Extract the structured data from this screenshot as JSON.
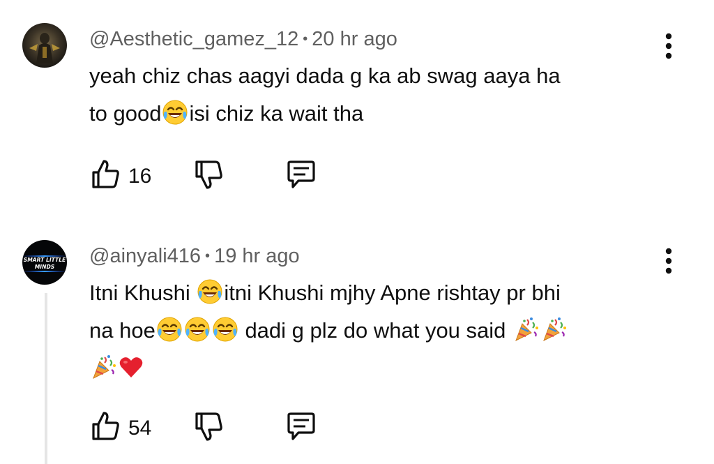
{
  "comments": [
    {
      "author": "@Aesthetic_gamez_12",
      "time": "20 hr ago",
      "separator": "•",
      "text_lines": [
        [
          {
            "t": "yeah chiz chas aagyi dada g ka ab swag aaya ha"
          }
        ],
        [
          {
            "t": "to good"
          },
          {
            "e": "joy"
          },
          {
            "t": "isi chiz ka wait tha"
          }
        ]
      ],
      "likes": "16",
      "avatar_icon": "avatar-gamer-figure"
    },
    {
      "author": "@ainyali416",
      "time": "19 hr ago",
      "separator": "•",
      "avatar_text": [
        "SMART LITTLE",
        "MINDS"
      ],
      "text_lines": [
        [
          {
            "t": "Itni Khushi "
          },
          {
            "e": "joy"
          },
          {
            "t": "itni Khushi mjhy Apne rishtay pr bhi"
          }
        ],
        [
          {
            "t": "na hoe"
          },
          {
            "e": "joy"
          },
          {
            "e": "joy"
          },
          {
            "e": "joy"
          },
          {
            "t": " dadi g plz do what you said "
          },
          {
            "e": "party"
          },
          {
            "e": "party"
          }
        ],
        [
          {
            "e": "party"
          },
          {
            "e": "heart"
          }
        ]
      ],
      "likes": "54"
    }
  ],
  "icons": {
    "like": "thumb-up-icon",
    "dislike": "thumb-down-icon",
    "reply": "reply-comment-icon",
    "more": "more-vert-icon"
  },
  "colors": {
    "text": "#0f0f0f",
    "meta": "#606060",
    "avatar_glow": "#3aa0ff"
  }
}
